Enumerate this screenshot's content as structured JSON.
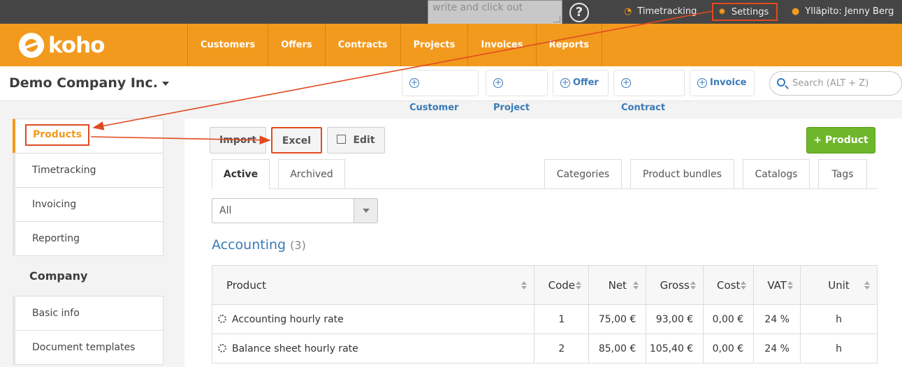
{
  "topbar": {
    "note_placeholder": "write and click out",
    "help": "?",
    "timetracking": "Timetracking",
    "settings": "Settings",
    "user": "Ylläpito: Jenny Berg"
  },
  "brand": {
    "logo": "koho"
  },
  "nav": [
    "Customers",
    "Offers",
    "Contracts",
    "Projects",
    "Invoices",
    "Reports"
  ],
  "subheader": {
    "company": "Demo Company Inc.",
    "quick": [
      "Customer",
      "Project",
      "Offer",
      "Contract",
      "Invoice"
    ],
    "search_placeholder": "Search (ALT + Z)"
  },
  "sidebar": {
    "items": [
      "Products",
      "Timetracking",
      "Invoicing",
      "Reporting"
    ],
    "company_heading": "Company",
    "company_items": [
      "Basic info",
      "Document templates"
    ]
  },
  "toolbar": {
    "import": "Import",
    "excel": "Excel",
    "edit": "Edit",
    "add_product": "+ Product"
  },
  "tabs": {
    "left": [
      "Active",
      "Archived"
    ],
    "right": [
      "Categories",
      "Product bundles",
      "Catalogs",
      "Tags"
    ]
  },
  "filter": {
    "selected": "All"
  },
  "section": {
    "title": "Accounting",
    "count": "(3)"
  },
  "table": {
    "headers": [
      "Product",
      "Code",
      "Net",
      "Gross",
      "Cost",
      "VAT",
      "Unit"
    ],
    "rows": [
      [
        "Accounting hourly rate",
        "1",
        "75,00 €",
        "93,00 €",
        "0,00 €",
        "24 %",
        "h"
      ],
      [
        "Balance sheet hourly rate",
        "2",
        "85,00 €",
        "105,40 €",
        "0,00 €",
        "24 %",
        "h"
      ]
    ]
  },
  "colors": {
    "brand_orange": "#f29a1e",
    "annotation_red": "#e14a1f",
    "link_blue": "#3a7ab7",
    "success_green": "#6eb62a"
  }
}
